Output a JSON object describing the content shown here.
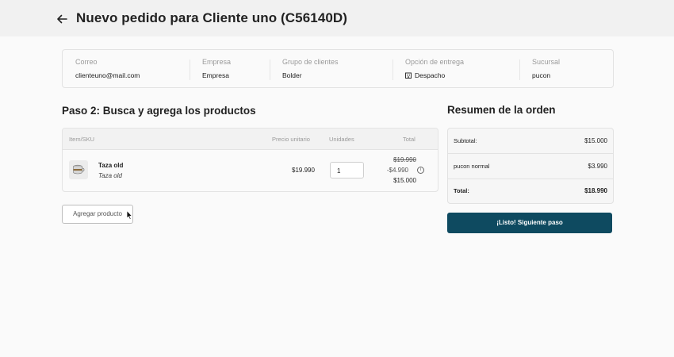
{
  "header": {
    "title": "Nuevo pedido para Cliente uno  (C56140D)",
    "back_icon": "arrow-left-icon"
  },
  "customer_info": {
    "email_label": "Correo",
    "email_value": "clienteuno@mail.com",
    "company_label": "Empresa",
    "company_value": "Empresa",
    "group_label": "Grupo de clientes",
    "group_value": "Bolder",
    "delivery_label": "Opción de entrega",
    "delivery_value": "Despacho",
    "delivery_icon": "building-icon",
    "branch_label": "Sucursal",
    "branch_value": "pucon"
  },
  "products_section": {
    "title": "Paso 2: Busca y agrega los productos",
    "columns": {
      "item": "Item/SKU",
      "unit_price": "Precio unitario",
      "units": "Unidades",
      "total": "Total"
    },
    "rows": [
      {
        "name": "Taza old",
        "sku": "Taza old",
        "image_icon": "mug-icon",
        "unit_price": "$19.990",
        "quantity": "1",
        "total_original": "$19.990",
        "discount": "-$4.990",
        "total_final": "$15.000"
      }
    ],
    "add_button": "Agregar producto"
  },
  "summary": {
    "title": "Resumen de la orden",
    "rows": [
      {
        "label": "Subtotal:",
        "value": "$15.000"
      },
      {
        "label": "pucon normal",
        "value": "$3.990"
      },
      {
        "label": "Total:",
        "value": "$18.990"
      }
    ],
    "next_button": "¡Listo! Siguiente paso"
  },
  "colors": {
    "primary": "#0e4a60",
    "background": "#fafafa",
    "header_bg": "#f1f1f1"
  }
}
